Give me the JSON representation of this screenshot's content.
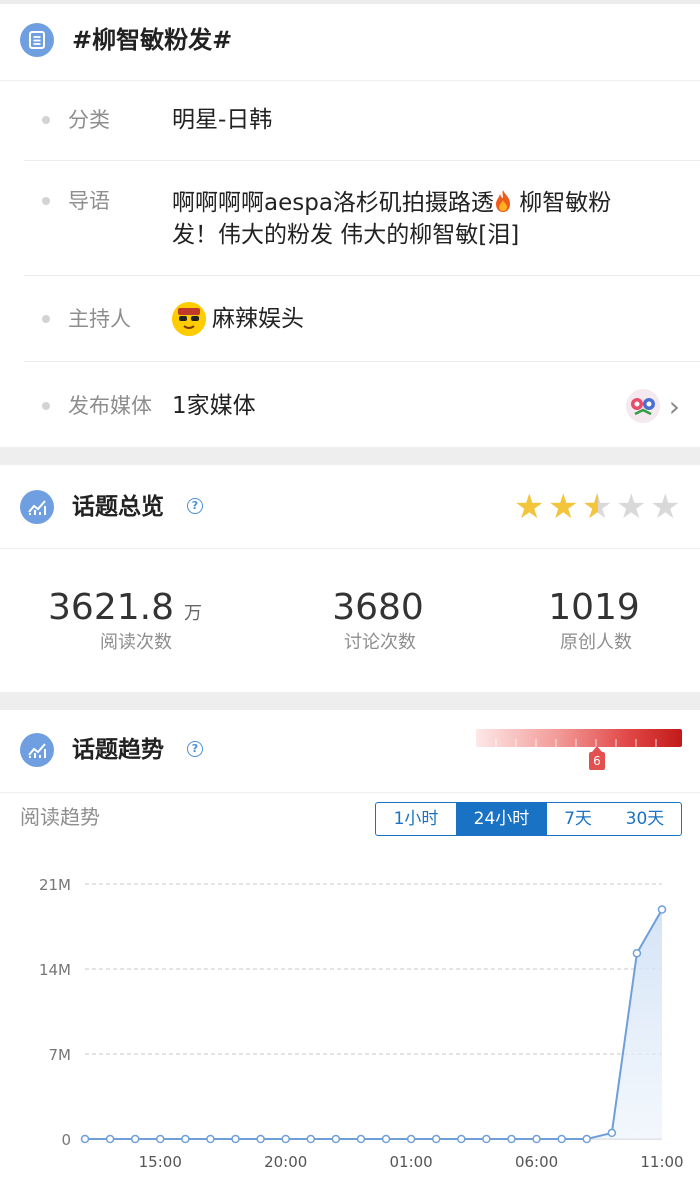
{
  "topic": {
    "title": "#柳智敏粉发#",
    "icon": "list-icon"
  },
  "info": {
    "category": {
      "label": "分类",
      "value": "明星-日韩"
    },
    "intro": {
      "label": "导语",
      "line1": "啊啊啊啊aespa洛杉矶拍摄路透",
      "line1b": "柳智敏粉",
      "line2": "发！伟大的粉发 伟大的柳智敏[泪]"
    },
    "host": {
      "label": "主持人",
      "value": "麻辣娱头"
    },
    "media": {
      "label": "发布媒体",
      "value": "1家媒体"
    }
  },
  "overview": {
    "title": "话题总览",
    "rating": 2.5,
    "stats": [
      {
        "value": "3621.8",
        "unit": "万",
        "label": "阅读次数"
      },
      {
        "value": "3680",
        "unit": "",
        "label": "讨论次数"
      },
      {
        "value": "1019",
        "unit": "",
        "label": "原创人数"
      }
    ]
  },
  "trend": {
    "title": "话题趋势",
    "heat_level": "6",
    "sub_label": "阅读趋势",
    "tabs": [
      "1小时",
      "24小时",
      "7天",
      "30天"
    ],
    "active_tab": "24小时"
  },
  "colors": {
    "accent": "#1a72c4",
    "line": "#6f9fd8",
    "star": "#f2c53a"
  },
  "chart_data": {
    "type": "area",
    "y_tick_labels": [
      "0",
      "7M",
      "14M",
      "21M"
    ],
    "ylim": [
      0,
      21
    ],
    "x_tick_labels": [
      "15:00",
      "20:00",
      "01:00",
      "06:00",
      "11:00"
    ],
    "series": [
      {
        "values": [
          0,
          0,
          0,
          0,
          0,
          0,
          0,
          0,
          0,
          0,
          0,
          0,
          0,
          0,
          0,
          0,
          0,
          0,
          0,
          0,
          0,
          0.5,
          15.3,
          18.9
        ]
      }
    ]
  }
}
